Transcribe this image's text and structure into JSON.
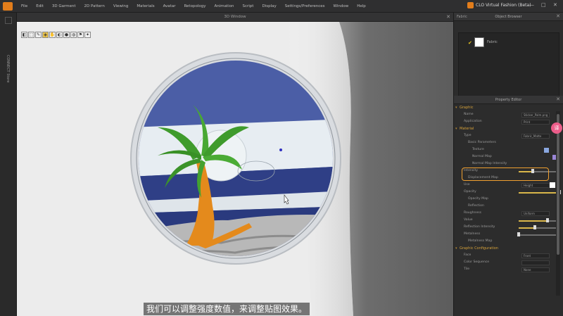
{
  "menubar": {
    "items": [
      "File",
      "Edit",
      "3D Garment",
      "2D Pattern",
      "Viewing",
      "Materials",
      "Avatar",
      "Retopology",
      "Animation",
      "Script",
      "Display",
      "Settings/Preferences",
      "Window",
      "Help"
    ],
    "app_title": "CLO Virtual Fashion (Beta)",
    "minimize": "—",
    "maximize": "□",
    "close": "✕"
  },
  "left_strip": {
    "label": "CONNECT Store"
  },
  "window3d": {
    "title": "3D Window",
    "close": "✕",
    "tools": [
      "◧",
      "⬚",
      "✎",
      "◈",
      "✋",
      "◐",
      "●",
      "◍",
      "⚑",
      "✦"
    ]
  },
  "object_panel": {
    "tab": "Fabric",
    "title": "Object Browser",
    "items": [
      {
        "label": "Fabric",
        "color": "#ffffff"
      }
    ]
  },
  "property_panel": {
    "title": "Property Editor",
    "rows": [
      {
        "kind": "section",
        "label": "Graphic"
      },
      {
        "kind": "field",
        "label": "Name",
        "value": "Sticker_Palm.png"
      },
      {
        "kind": "field",
        "label": "Application",
        "value": "Print"
      },
      {
        "kind": "section",
        "label": "Material"
      },
      {
        "kind": "field",
        "label": "Type",
        "value": "Fabric_Matte"
      },
      {
        "kind": "sub",
        "label": "Basic Parameters"
      },
      {
        "kind": "sub2",
        "label": "Texture"
      },
      {
        "kind": "sub2",
        "label": "Normal Map"
      },
      {
        "kind": "sub2",
        "label": "Normal Map Intensity"
      },
      {
        "kind": "slider",
        "label": "Intensity",
        "value": 35
      },
      {
        "kind": "sub",
        "label": "Displacement Map"
      },
      {
        "kind": "field",
        "label": "Use",
        "value": "Height"
      },
      {
        "kind": "slider",
        "label": "Opacity",
        "value": 100
      },
      {
        "kind": "sub",
        "label": "Opacity Map"
      },
      {
        "kind": "sub",
        "label": "Reflection"
      },
      {
        "kind": "field",
        "label": "Roughness",
        "value": "Uniform"
      },
      {
        "kind": "slider",
        "label": "Value",
        "value": 70
      },
      {
        "kind": "slider",
        "label": "Reflection Intensity",
        "value": 40
      },
      {
        "kind": "slider",
        "label": "Metalness",
        "value": 0
      },
      {
        "kind": "sub",
        "label": "Metalness Map"
      },
      {
        "kind": "section",
        "label": "Graphic Configuration"
      },
      {
        "kind": "field",
        "label": "Face",
        "value": "Front"
      },
      {
        "kind": "field",
        "label": "Color Sequence",
        "value": ""
      },
      {
        "kind": "field",
        "label": "Tile",
        "value": "None"
      }
    ]
  },
  "subtitle": "我们可以调整强度数值，来调整贴图效果。",
  "side_badge": "译",
  "colors": {
    "accent": "#e27d1b",
    "highlight": "#f0a030",
    "section_text": "#d6a23a"
  }
}
